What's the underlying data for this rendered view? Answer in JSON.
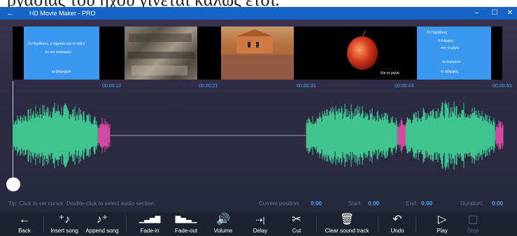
{
  "caption_text": "ργασίας του ήχου γίνεται καλώς ετσι.",
  "window": {
    "title": "HD Movie Maker - PRO",
    "back_glyph": "←",
    "min_glyph": "–",
    "max_glyph": "☐",
    "close_glyph": "✕"
  },
  "thumbs": [
    {
      "lines": [
        "Οι Παρθένιες, ο λαμπαιν και το ιαθετι",
        "ότι τον επικαιρόει",
        "εκ βιομηχανι"
      ]
    },
    {
      "lines": []
    },
    {
      "lines": []
    },
    {
      "lines": [
        "Και το μηλιό"
      ]
    },
    {
      "lines": [
        "Οι Παρθένιες",
        "Η Κόρφον",
        "στη τη μήλα",
        "το λεγομενο",
        "το άδερφος"
      ]
    }
  ],
  "timeline": {
    "ticks": [
      "00:00:10",
      "00:00:21",
      "00:00:33",
      "00:00:43",
      "00:00:53"
    ]
  },
  "status": {
    "tip": "Tip: Click to set cursor. Double-click to select audio section.",
    "current_label": "Current position:",
    "current_value": "0:00",
    "start_label": "Start:",
    "start_value": "0:00",
    "end_label": "End:",
    "end_value": "0:00",
    "duration_label": "Duration:",
    "duration_value": "0:00"
  },
  "toolbar": [
    {
      "icon": "←",
      "label": "Back"
    },
    {
      "icon": "⁺♪",
      "label": "Insert song"
    },
    {
      "icon": "♪⁺",
      "label": "Append song"
    },
    {
      "icon": "▁▃▅▇",
      "label": "Fade-in"
    },
    {
      "icon": "▇▅▃▁",
      "label": "Fade-out"
    },
    {
      "icon": "🔊",
      "label": "Volume"
    },
    {
      "icon": "⇢|",
      "label": "Delay"
    },
    {
      "icon": "✂",
      "label": "Cut"
    },
    {
      "icon": "🗑",
      "label": "Clear sound track"
    },
    {
      "icon": "↶",
      "label": "Undo"
    },
    {
      "icon": "▷",
      "label": "Play"
    },
    {
      "icon": "▢",
      "label": "Stop"
    }
  ],
  "colors": {
    "titlebar": "#1664c6",
    "wave_green": "#3fc48f",
    "wave_pink": "#d04aa0",
    "accent_blue": "#4aa0e8"
  }
}
